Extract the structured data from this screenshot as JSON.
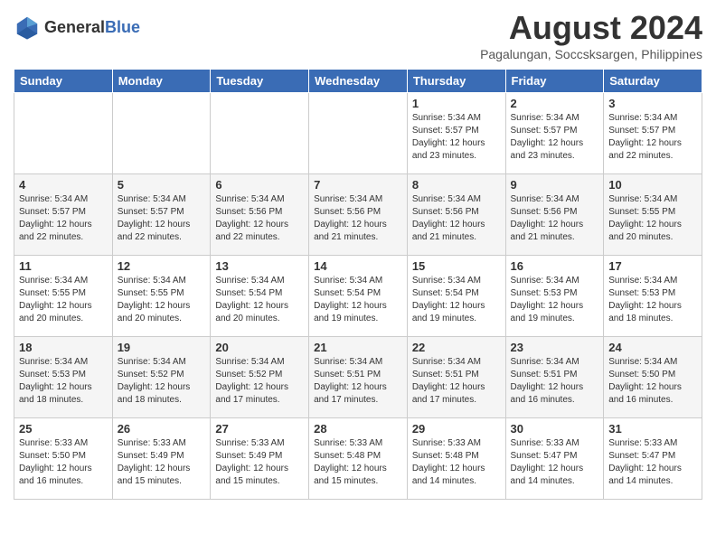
{
  "header": {
    "logo_general": "General",
    "logo_blue": "Blue",
    "month_year": "August 2024",
    "location": "Pagalungan, Soccsksargen, Philippines"
  },
  "days_of_week": [
    "Sunday",
    "Monday",
    "Tuesday",
    "Wednesday",
    "Thursday",
    "Friday",
    "Saturday"
  ],
  "weeks": [
    [
      {
        "day": "",
        "sunrise": "",
        "sunset": "",
        "daylight": ""
      },
      {
        "day": "",
        "sunrise": "",
        "sunset": "",
        "daylight": ""
      },
      {
        "day": "",
        "sunrise": "",
        "sunset": "",
        "daylight": ""
      },
      {
        "day": "",
        "sunrise": "",
        "sunset": "",
        "daylight": ""
      },
      {
        "day": "1",
        "sunrise": "5:34 AM",
        "sunset": "5:57 PM",
        "daylight": "12 hours and 23 minutes."
      },
      {
        "day": "2",
        "sunrise": "5:34 AM",
        "sunset": "5:57 PM",
        "daylight": "12 hours and 23 minutes."
      },
      {
        "day": "3",
        "sunrise": "5:34 AM",
        "sunset": "5:57 PM",
        "daylight": "12 hours and 22 minutes."
      }
    ],
    [
      {
        "day": "4",
        "sunrise": "5:34 AM",
        "sunset": "5:57 PM",
        "daylight": "12 hours and 22 minutes."
      },
      {
        "day": "5",
        "sunrise": "5:34 AM",
        "sunset": "5:57 PM",
        "daylight": "12 hours and 22 minutes."
      },
      {
        "day": "6",
        "sunrise": "5:34 AM",
        "sunset": "5:56 PM",
        "daylight": "12 hours and 22 minutes."
      },
      {
        "day": "7",
        "sunrise": "5:34 AM",
        "sunset": "5:56 PM",
        "daylight": "12 hours and 21 minutes."
      },
      {
        "day": "8",
        "sunrise": "5:34 AM",
        "sunset": "5:56 PM",
        "daylight": "12 hours and 21 minutes."
      },
      {
        "day": "9",
        "sunrise": "5:34 AM",
        "sunset": "5:56 PM",
        "daylight": "12 hours and 21 minutes."
      },
      {
        "day": "10",
        "sunrise": "5:34 AM",
        "sunset": "5:55 PM",
        "daylight": "12 hours and 20 minutes."
      }
    ],
    [
      {
        "day": "11",
        "sunrise": "5:34 AM",
        "sunset": "5:55 PM",
        "daylight": "12 hours and 20 minutes."
      },
      {
        "day": "12",
        "sunrise": "5:34 AM",
        "sunset": "5:55 PM",
        "daylight": "12 hours and 20 minutes."
      },
      {
        "day": "13",
        "sunrise": "5:34 AM",
        "sunset": "5:54 PM",
        "daylight": "12 hours and 20 minutes."
      },
      {
        "day": "14",
        "sunrise": "5:34 AM",
        "sunset": "5:54 PM",
        "daylight": "12 hours and 19 minutes."
      },
      {
        "day": "15",
        "sunrise": "5:34 AM",
        "sunset": "5:54 PM",
        "daylight": "12 hours and 19 minutes."
      },
      {
        "day": "16",
        "sunrise": "5:34 AM",
        "sunset": "5:53 PM",
        "daylight": "12 hours and 19 minutes."
      },
      {
        "day": "17",
        "sunrise": "5:34 AM",
        "sunset": "5:53 PM",
        "daylight": "12 hours and 18 minutes."
      }
    ],
    [
      {
        "day": "18",
        "sunrise": "5:34 AM",
        "sunset": "5:53 PM",
        "daylight": "12 hours and 18 minutes."
      },
      {
        "day": "19",
        "sunrise": "5:34 AM",
        "sunset": "5:52 PM",
        "daylight": "12 hours and 18 minutes."
      },
      {
        "day": "20",
        "sunrise": "5:34 AM",
        "sunset": "5:52 PM",
        "daylight": "12 hours and 17 minutes."
      },
      {
        "day": "21",
        "sunrise": "5:34 AM",
        "sunset": "5:51 PM",
        "daylight": "12 hours and 17 minutes."
      },
      {
        "day": "22",
        "sunrise": "5:34 AM",
        "sunset": "5:51 PM",
        "daylight": "12 hours and 17 minutes."
      },
      {
        "day": "23",
        "sunrise": "5:34 AM",
        "sunset": "5:51 PM",
        "daylight": "12 hours and 16 minutes."
      },
      {
        "day": "24",
        "sunrise": "5:34 AM",
        "sunset": "5:50 PM",
        "daylight": "12 hours and 16 minutes."
      }
    ],
    [
      {
        "day": "25",
        "sunrise": "5:33 AM",
        "sunset": "5:50 PM",
        "daylight": "12 hours and 16 minutes."
      },
      {
        "day": "26",
        "sunrise": "5:33 AM",
        "sunset": "5:49 PM",
        "daylight": "12 hours and 15 minutes."
      },
      {
        "day": "27",
        "sunrise": "5:33 AM",
        "sunset": "5:49 PM",
        "daylight": "12 hours and 15 minutes."
      },
      {
        "day": "28",
        "sunrise": "5:33 AM",
        "sunset": "5:48 PM",
        "daylight": "12 hours and 15 minutes."
      },
      {
        "day": "29",
        "sunrise": "5:33 AM",
        "sunset": "5:48 PM",
        "daylight": "12 hours and 14 minutes."
      },
      {
        "day": "30",
        "sunrise": "5:33 AM",
        "sunset": "5:47 PM",
        "daylight": "12 hours and 14 minutes."
      },
      {
        "day": "31",
        "sunrise": "5:33 AM",
        "sunset": "5:47 PM",
        "daylight": "12 hours and 14 minutes."
      }
    ]
  ]
}
